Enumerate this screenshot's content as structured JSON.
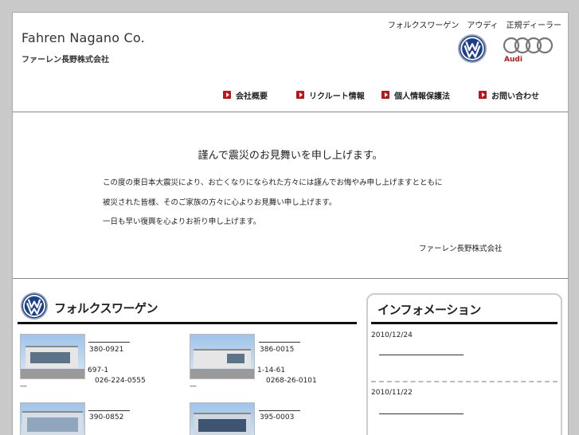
{
  "header": {
    "company_en": "Fahren Nagano Co.",
    "company_ja": "ファーレン長野株式会社",
    "tagline": "フォルクスワーゲン　アウディ　正規ディーラー",
    "vw_logo_text": "VW",
    "audi_logo_text": "Audi"
  },
  "nav": [
    {
      "label": "会社概要"
    },
    {
      "label": "リクルート情報"
    },
    {
      "label": "個人情報保護法"
    },
    {
      "label": "お問い合わせ"
    }
  ],
  "message": {
    "title": "謹んで震災のお見舞いを申し上げます。",
    "lines": [
      "この度の東日本大震災により、お亡くなりになられた方々には謹んでお悔やみ申し上げますとともに",
      "被災された皆様、そのご家族の方々に心よりお見舞い申し上げます。",
      "一日も早い復興を心よりお祈り申し上げます。"
    ],
    "signature": "ファーレン長野株式会社"
  },
  "vw_section": {
    "title": "フォルクスワーゲン",
    "dealers": [
      {
        "zip": "380-0921",
        "addr": "697-1",
        "tel": "026-224-0555",
        "extra": "—"
      },
      {
        "zip": "386-0015",
        "addr": "1-14-61",
        "tel": "0268-26-0101",
        "extra": "—"
      },
      {
        "zip": "390-0852",
        "addr": "",
        "tel": "",
        "extra": ""
      },
      {
        "zip": "395-0003",
        "addr": "",
        "tel": "",
        "extra": ""
      }
    ]
  },
  "info": {
    "title": "インフォメーション",
    "items": [
      {
        "date": "2010/12/24"
      },
      {
        "date": "2010/11/22"
      }
    ]
  },
  "colors": {
    "nav_bullet": "#c0141b",
    "page_bg": "#c9c9c9",
    "vw_blue": "#1b3f8f"
  }
}
